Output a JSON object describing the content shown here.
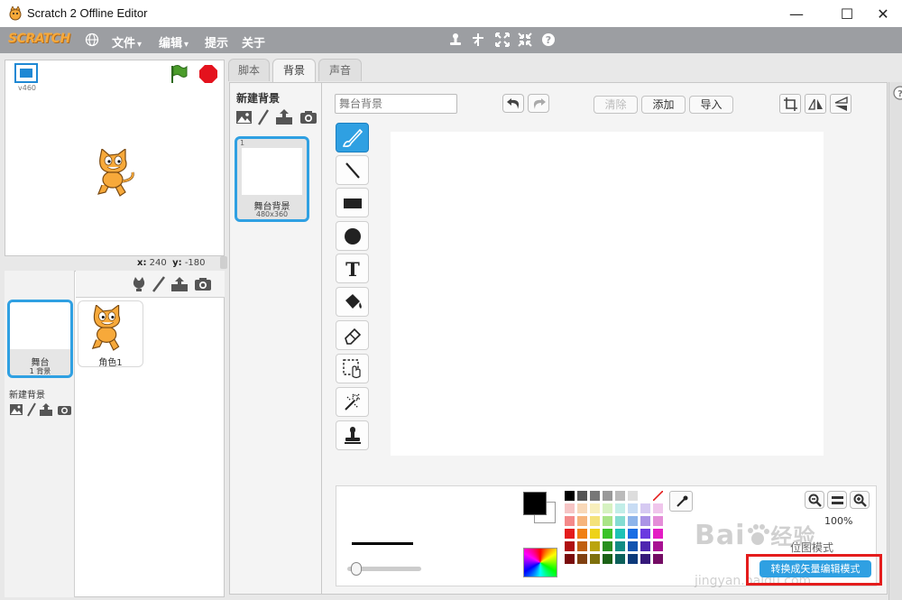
{
  "window": {
    "title": "Scratch 2 Offline Editor",
    "minimize": "—",
    "maximize": "☐",
    "close": "✕"
  },
  "menubar": {
    "logo": "SCRATCH",
    "items": [
      "文件",
      "编辑",
      "提示",
      "关于"
    ],
    "dropdown_arrow": "▾",
    "tool_icons": [
      "duplicate-icon",
      "cut-icon",
      "grow-icon",
      "shrink-icon",
      "help-icon"
    ]
  },
  "stage": {
    "version_label": "v460",
    "x_label": "x:",
    "x_value": "240",
    "y_label": "y:",
    "y_value": "-180"
  },
  "sprites": {
    "stage_label": "舞台",
    "stage_sub": "1 背景",
    "new_backdrop_label": "新建背景",
    "sprite1_name": "角色1"
  },
  "tabs": [
    "脚本",
    "背景",
    "声音"
  ],
  "active_tab": "背景",
  "backdrops": {
    "new_label": "新建背景",
    "items": [
      {
        "index": "1",
        "name": "舞台背景",
        "size": "480x360"
      }
    ]
  },
  "editor": {
    "name_placeholder": "舞台背景",
    "buttons": {
      "clear": "清除",
      "add": "添加",
      "import": "导入"
    },
    "tools": [
      "brush-icon",
      "line-icon",
      "rectangle-icon",
      "ellipse-icon",
      "text-icon",
      "fill-icon",
      "eraser-icon",
      "select-icon",
      "magic-select-icon",
      "stamp-icon"
    ],
    "zoom": "100%",
    "mode_label": "位图模式",
    "convert_button": "转换成矢量编辑模式",
    "colors": {
      "selected": "#000000",
      "accent": "#2fa0e2",
      "highlight": "#e41c1c"
    }
  },
  "watermark": {
    "brand": "Bai",
    "brand_cn": "经验",
    "url": "jingyan.baidu.com"
  }
}
